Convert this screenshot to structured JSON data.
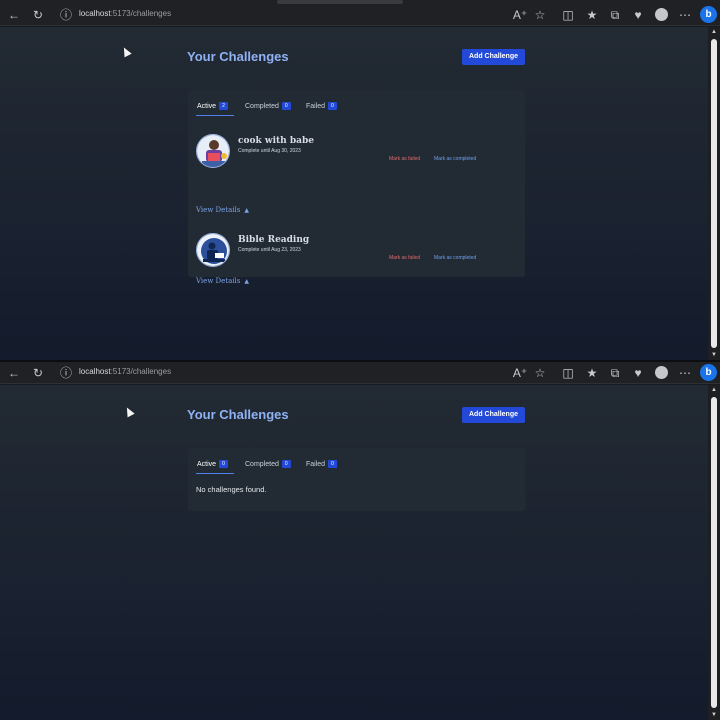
{
  "browser": {
    "url_host": "localhost",
    "url_rest": ":5173/challenges",
    "bing_label": "b"
  },
  "page": {
    "title": "Your Challenges",
    "add_label": "Add Challenge"
  },
  "tabs": [
    {
      "label": "Active",
      "count_top": "2",
      "count_bottom": "0"
    },
    {
      "label": "Completed",
      "count_top": "0",
      "count_bottom": "0"
    },
    {
      "label": "Failed",
      "count_top": "0",
      "count_bottom": "0"
    }
  ],
  "challenges": [
    {
      "title": "cook with babe",
      "subtitle": "Complete until Aug 30, 2023",
      "avatar_icon": "cooking-person-icon"
    },
    {
      "title": "Bible Reading",
      "subtitle": "Complete until Aug 23, 2023",
      "avatar_icon": "reading-person-icon"
    }
  ],
  "actions": {
    "failed": "Mark as failed",
    "completed": "Mark as completed",
    "view_details": "View Details"
  },
  "empty_text": "No challenges found.",
  "colors": {
    "accent": "#2249d8",
    "title": "#8fb2f5",
    "failed": "#e06a6a",
    "completed": "#6fa0ec"
  }
}
